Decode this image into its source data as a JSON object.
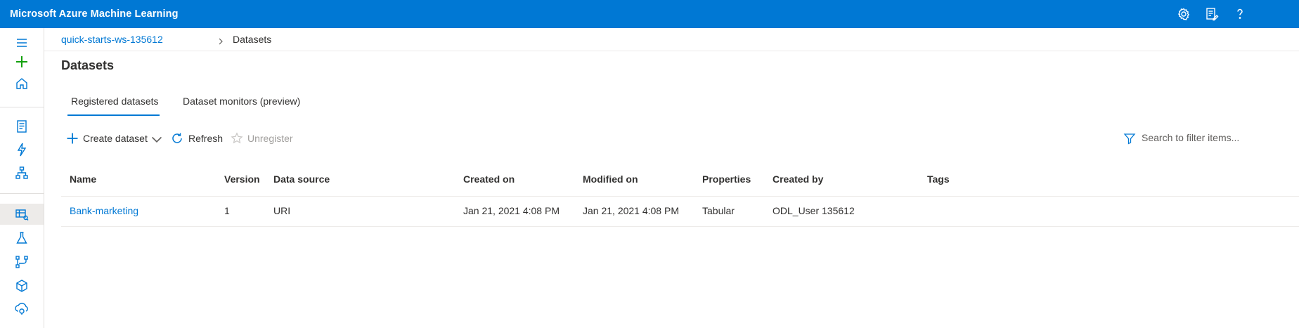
{
  "app": {
    "title": "Microsoft Azure Machine Learning"
  },
  "topbar": {
    "icons": [
      "gear-icon",
      "feedback-icon",
      "help-icon"
    ],
    "accent": "#0078d4"
  },
  "leftnav": {
    "icons": [
      "hamburger-menu-icon",
      "plus-icon",
      "home-icon",
      "notebook-icon",
      "automl-icon",
      "designer-icon",
      "datasets-icon",
      "experiments-icon",
      "pipelines-icon",
      "models-icon",
      "endpoints-icon"
    ],
    "selected": "datasets-icon"
  },
  "breadcrumb": {
    "workspace": "quick-starts-ws-135612",
    "current": "Datasets"
  },
  "page": {
    "title": "Datasets"
  },
  "tabs": [
    {
      "label": "Registered datasets",
      "active": true
    },
    {
      "label": "Dataset monitors (preview)",
      "active": false
    }
  ],
  "toolbar": {
    "create": "Create dataset",
    "refresh": "Refresh",
    "unregister": "Unregister",
    "search_placeholder": "Search to filter items..."
  },
  "table": {
    "columns": [
      "Name",
      "Version",
      "Data source",
      "Created on",
      "Modified on",
      "Properties",
      "Created by",
      "Tags"
    ],
    "rows": [
      {
        "name": "Bank-marketing",
        "version": "1",
        "data_source": "URI",
        "created_on": "Jan 21, 2021 4:08 PM",
        "modified_on": "Jan 21, 2021 4:08 PM",
        "properties": "Tabular",
        "created_by": "ODL_User 135612",
        "tags": ""
      }
    ]
  }
}
